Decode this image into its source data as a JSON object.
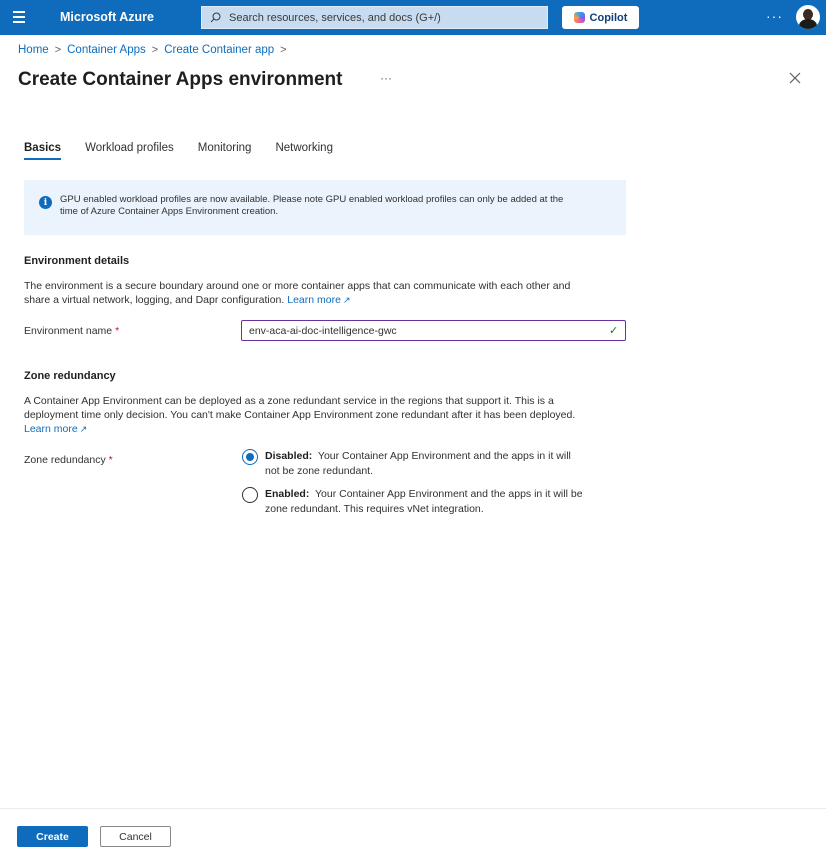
{
  "topbar": {
    "brand": "Microsoft Azure",
    "search_placeholder": "Search resources, services, and docs (G+/)",
    "copilot_label": "Copilot",
    "more": "···"
  },
  "breadcrumb": {
    "items": [
      "Home",
      "Container Apps",
      "Create Container app"
    ],
    "separator": ">"
  },
  "page": {
    "title": "Create Container Apps environment",
    "more": "···"
  },
  "tabs": [
    "Basics",
    "Workload profiles",
    "Monitoring",
    "Networking"
  ],
  "info_banner": {
    "line1": "GPU enabled workload profiles are now available. Please note GPU enabled workload profiles can only be added at the",
    "line2": "time of Azure Container Apps Environment creation."
  },
  "environment_details": {
    "heading": "Environment details",
    "description_line1": "The environment is a secure boundary around one or more container apps that can communicate with each other and",
    "description_line2": "share a virtual network, logging, and Dapr configuration.",
    "learn_more": "Learn more",
    "name_label": "Environment name",
    "required_mark": "*",
    "name_value": "env-aca-ai-doc-intelligence-gwc"
  },
  "zone_redundancy": {
    "heading": "Zone redundancy",
    "description_line1": "A Container App Environment can be deployed as a zone redundant service in the regions that support it. This is a",
    "description_line2": "deployment time only decision. You can't make Container App Environment zone redundant after it has been deployed.",
    "learn_more": "Learn more",
    "label": "Zone redundancy",
    "required_mark": "*",
    "options": [
      {
        "title": "Disabled:",
        "line1": "Your Container App Environment and the apps in it will",
        "line2": "not be zone redundant.",
        "selected": true
      },
      {
        "title": "Enabled:",
        "line1": "Your Container App Environment and the apps in it will be",
        "line2": "zone redundant. This requires vNet integration.",
        "selected": false
      }
    ]
  },
  "footer": {
    "create_label": "Create",
    "cancel_label": "Cancel"
  },
  "colors": {
    "accent": "#0f6cbd",
    "input_border": "#6b2fa0",
    "success": "#107c10",
    "required": "#a4262c"
  }
}
